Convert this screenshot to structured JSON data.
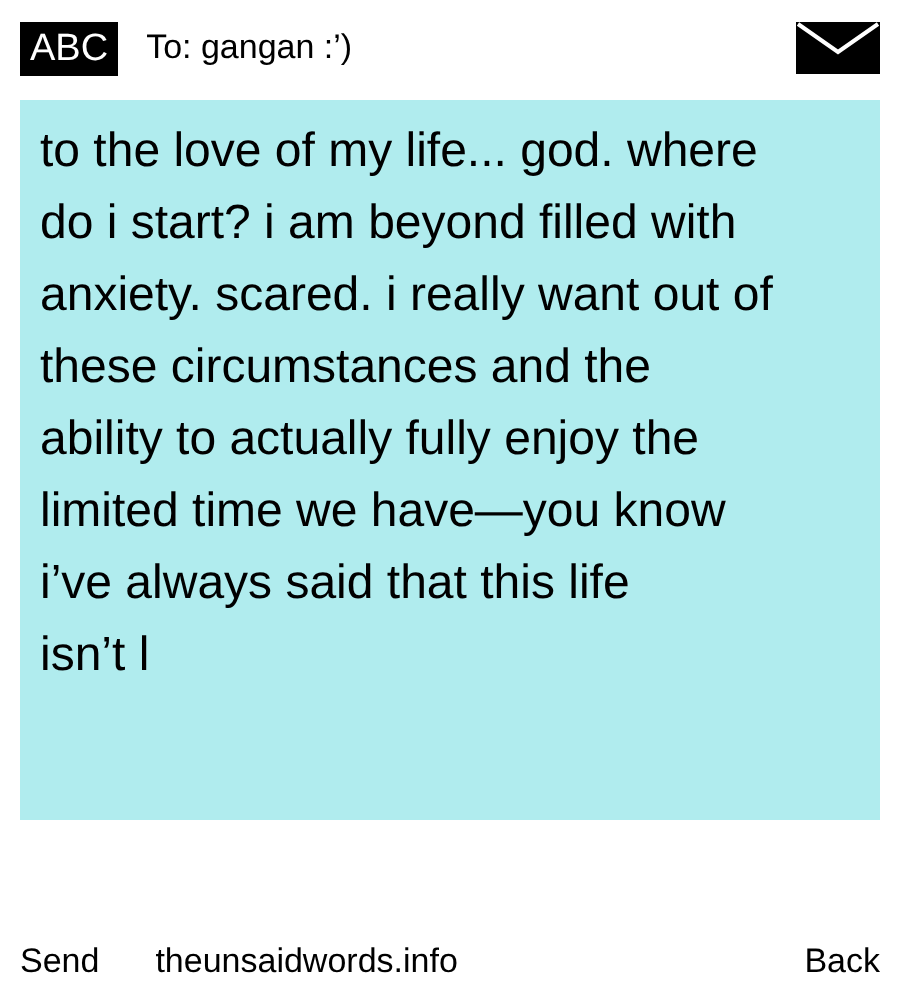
{
  "header": {
    "mode_badge": "ABC",
    "recipient": "To: gangan :’)"
  },
  "message": {
    "body": "to the love of my life... god. where do i start? i am beyond filled with anxiety. scared. i really want out of these circumstances and the ability to actually fully enjoy the limited time we have—you know i’ve always said that this life\nisn’t l"
  },
  "footer": {
    "left": "Send",
    "center": "theunsaidwords.info",
    "right": "Back"
  }
}
